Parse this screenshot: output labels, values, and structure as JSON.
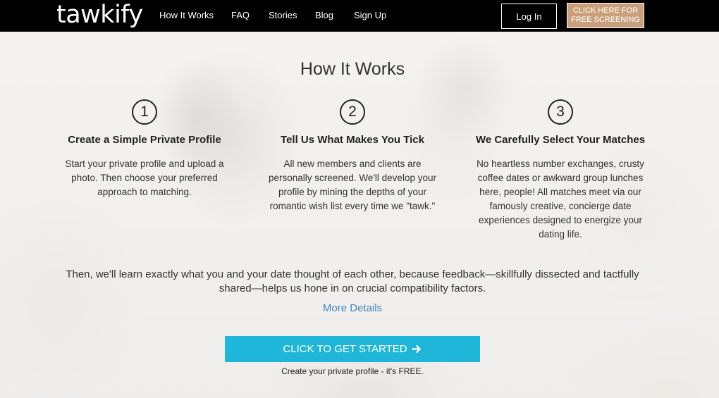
{
  "brand": {
    "logo": "tawkify"
  },
  "nav": {
    "links": [
      "How It Works",
      "FAQ",
      "Stories",
      "Blog",
      "Sign Up"
    ],
    "login_label": "Log In",
    "screening_line1": "CLICK HERE FOR",
    "screening_line2": "FREE SCREENING",
    "accent_color": "#c9a07b"
  },
  "main": {
    "heading": "How It Works",
    "steps": [
      {
        "number": "1",
        "title": "Create a Simple Private Profile",
        "text": "Start your private profile and upload a photo. Then choose your preferred approach to matching."
      },
      {
        "number": "2",
        "title": "Tell Us What Makes You Tick",
        "text": "All new members and clients are personally screened. We'll develop your profile by mining the depths of your romantic wish list every time we \"tawk.\""
      },
      {
        "number": "3",
        "title": "We Carefully Select Your Matches",
        "text": "No heartless number exchanges, crusty coffee dates or awkward group lunches here, people! All matches meet via our famously creative, concierge date experiences designed to energize your dating life."
      }
    ],
    "summary": "Then, we'll learn exactly what you and your date thought of each other, because feedback—skillfully dissected and tactfully shared—helps us hone in on crucial compatibility factors.",
    "more_details": "More Details",
    "cta_label": "CLICK TO GET STARTED",
    "cta_icon": "arrow-right-icon",
    "cta_color": "#1fb6d9",
    "cta_note": "Create your private profile - it's FREE."
  }
}
